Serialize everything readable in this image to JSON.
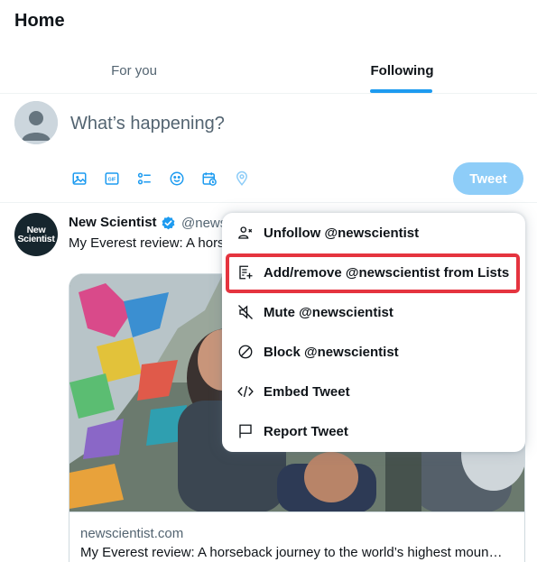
{
  "header": {
    "title": "Home",
    "tabs": [
      {
        "label": "For you",
        "active": false
      },
      {
        "label": "Following",
        "active": true
      }
    ]
  },
  "composer": {
    "placeholder": "What’s happening?",
    "tools": [
      "image-icon",
      "gif-icon",
      "poll-icon",
      "emoji-icon",
      "schedule-icon",
      "location-icon"
    ],
    "tweet_button": "Tweet"
  },
  "tweet": {
    "avatar_text": [
      "New",
      "Scientist"
    ],
    "author_name": "New Scientist",
    "handle": "@news",
    "text": "My Everest review: A hors",
    "card": {
      "domain": "newscientist.com",
      "title": "My Everest review: A horseback journey to the world’s highest moun…"
    }
  },
  "context_menu": {
    "items": [
      {
        "label": "Unfollow @newscientist",
        "icon": "unfollow-icon"
      },
      {
        "label": "Add/remove @newscientist from Lists",
        "icon": "lists-add-icon",
        "highlighted": true
      },
      {
        "label": "Mute @newscientist",
        "icon": "mute-icon"
      },
      {
        "label": "Block @newscientist",
        "icon": "block-icon"
      },
      {
        "label": "Embed Tweet",
        "icon": "embed-icon"
      },
      {
        "label": "Report Tweet",
        "icon": "report-flag-icon"
      }
    ]
  },
  "colors": {
    "accent": "#1d9bf0",
    "tweet_button_disabled": "#8ecdf8",
    "highlight_border": "#e5343f"
  }
}
